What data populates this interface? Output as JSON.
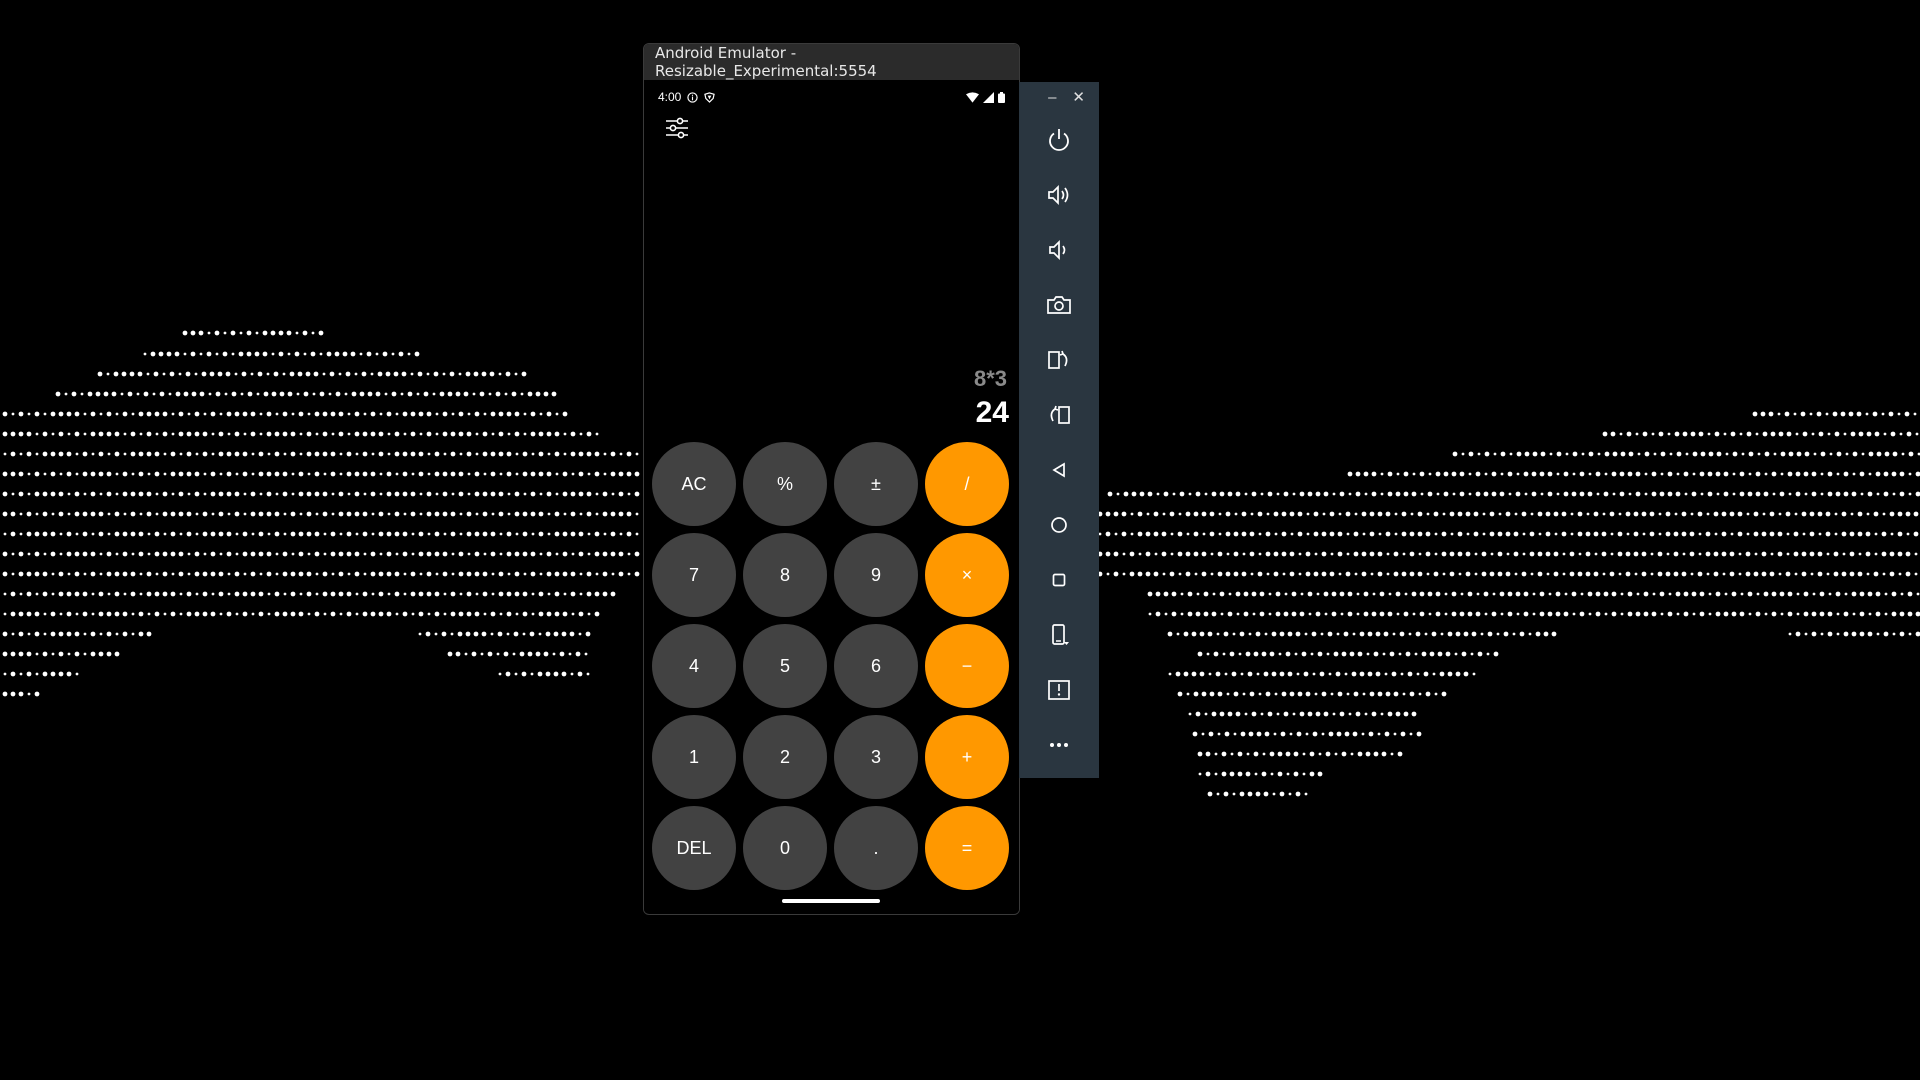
{
  "emulator": {
    "title": "Android Emulator - Resizable_Experimental:5554"
  },
  "statusbar": {
    "time": "4:00"
  },
  "calculator": {
    "expression": "8*3",
    "result": "24",
    "keys": [
      {
        "label": "AC",
        "type": "fn"
      },
      {
        "label": "%",
        "type": "fn"
      },
      {
        "label": "±",
        "type": "fn"
      },
      {
        "label": "/",
        "type": "op"
      },
      {
        "label": "7",
        "type": "num"
      },
      {
        "label": "8",
        "type": "num"
      },
      {
        "label": "9",
        "type": "num"
      },
      {
        "label": "×",
        "type": "op"
      },
      {
        "label": "4",
        "type": "num"
      },
      {
        "label": "5",
        "type": "num"
      },
      {
        "label": "6",
        "type": "num"
      },
      {
        "label": "−",
        "type": "op"
      },
      {
        "label": "1",
        "type": "num"
      },
      {
        "label": "2",
        "type": "num"
      },
      {
        "label": "3",
        "type": "num"
      },
      {
        "label": "+",
        "type": "op"
      },
      {
        "label": "DEL",
        "type": "fn"
      },
      {
        "label": "0",
        "type": "num"
      },
      {
        "label": ".",
        "type": "num"
      },
      {
        "label": "=",
        "type": "op"
      }
    ]
  },
  "toolbar": {
    "minimize_label": "–",
    "close_label": "✕",
    "buttons": [
      "power-icon",
      "volume-up-icon",
      "volume-down-icon",
      "camera-icon",
      "rotate-left-icon",
      "rotate-right-icon",
      "back-icon",
      "home-icon",
      "overview-icon",
      "fold-icon",
      "posture-icon",
      "more-icon"
    ]
  },
  "colors": {
    "accent": "#ff9800",
    "key": "#424242",
    "toolbar": "#2a3640"
  }
}
